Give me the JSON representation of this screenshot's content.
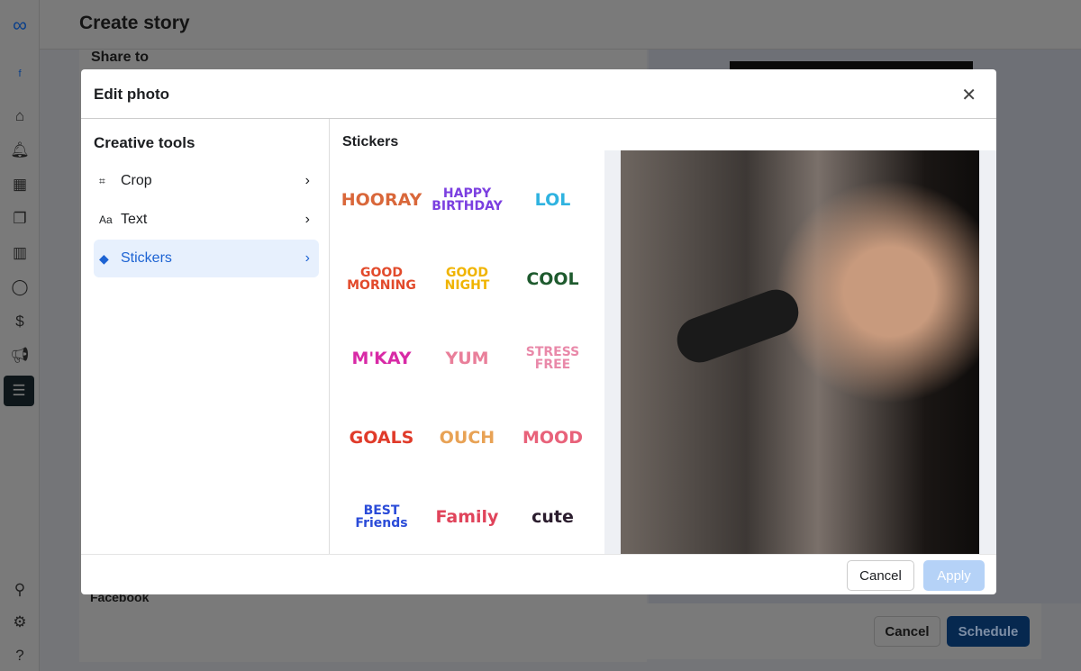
{
  "page": {
    "title": "Create story",
    "share_to": "Share to",
    "facebook_label": "Facebook",
    "cancel": "Cancel",
    "schedule": "Schedule"
  },
  "sidebar": {
    "icons": [
      "meta-logo-icon",
      "facebook-page-icon",
      "home-icon",
      "bell-icon",
      "calendar-icon",
      "content-icon",
      "insights-icon",
      "chat-icon",
      "dollar-icon",
      "megaphone-icon",
      "menu-icon",
      "search-icon",
      "gear-icon",
      "help-icon"
    ]
  },
  "modal": {
    "title": "Edit photo",
    "creative_tools_title": "Creative tools",
    "tools": [
      {
        "label": "Crop",
        "icon": "crop-icon"
      },
      {
        "label": "Text",
        "icon": "text-icon",
        "glyph": "Aa"
      },
      {
        "label": "Stickers",
        "icon": "sticker-icon",
        "active": true
      }
    ],
    "stickers_title": "Stickers",
    "stickers": [
      "HOORAY",
      "HAPPY BIRTHDAY",
      "LOL",
      "GOOD MORNING",
      "GOOD NIGHT",
      "COOL",
      "M'KAY",
      "YUM",
      "STRESS FREE",
      "GOALS",
      "OUCH",
      "MOOD",
      "BEST Friends",
      "Family",
      "cute"
    ],
    "cancel": "Cancel",
    "apply": "Apply"
  },
  "colors": {
    "accent": "#1d63d3",
    "schedule": "#0b4ea2",
    "apply_disabled": "#b5d2f7"
  }
}
